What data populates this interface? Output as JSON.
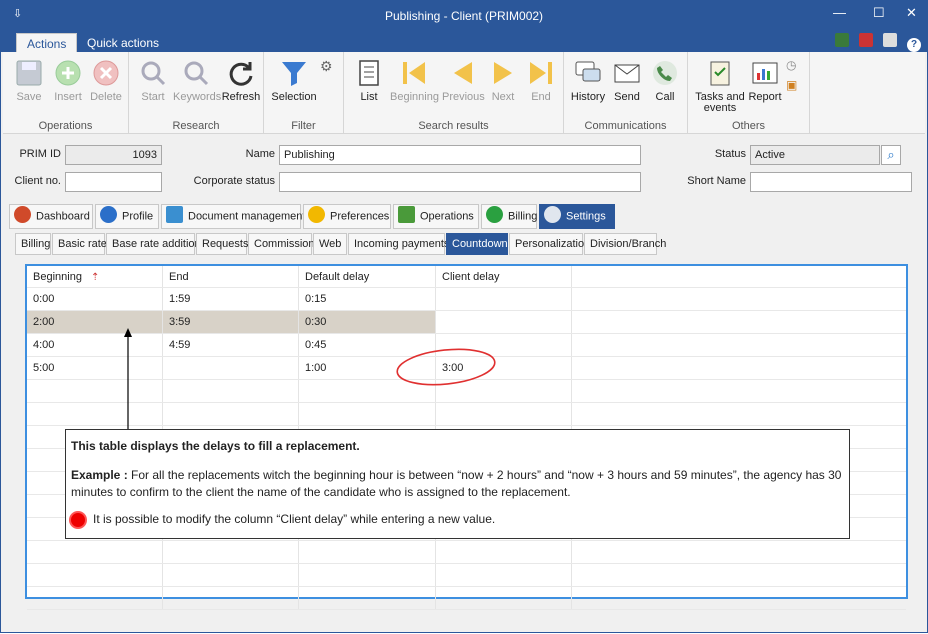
{
  "window": {
    "title": "Publishing - Client (PRIM002)",
    "menu_glyph": "⇩",
    "min": "—",
    "max": "☐",
    "close": "✕"
  },
  "ribbon_tabs": [
    {
      "label": "Actions"
    },
    {
      "label": "Quick actions"
    }
  ],
  "ribbon": {
    "groups": [
      {
        "label": "Operations",
        "buttons": [
          {
            "label": "Save",
            "enabled": false
          },
          {
            "label": "Insert",
            "enabled": false
          },
          {
            "label": "Delete",
            "enabled": false
          }
        ]
      },
      {
        "label": "Research",
        "buttons": [
          {
            "label": "Start",
            "enabled": false
          },
          {
            "label": "Keywords",
            "enabled": false
          },
          {
            "label": "Refresh",
            "enabled": true
          }
        ]
      },
      {
        "label": "Filter",
        "buttons": [
          {
            "label": "Selection",
            "enabled": true
          }
        ]
      },
      {
        "label": "Search results",
        "buttons": [
          {
            "label": "List",
            "enabled": true
          },
          {
            "label": "Beginning",
            "enabled": false
          },
          {
            "label": "Previous",
            "enabled": false
          },
          {
            "label": "Next",
            "enabled": false
          },
          {
            "label": "End",
            "enabled": false
          }
        ]
      },
      {
        "label": "Communications",
        "buttons": [
          {
            "label": "History",
            "enabled": true
          },
          {
            "label": "Send",
            "enabled": true
          },
          {
            "label": "Call",
            "enabled": true
          }
        ]
      },
      {
        "label": "Others",
        "buttons": [
          {
            "label": "Tasks and events",
            "line1": "Tasks and",
            "line2": "events",
            "enabled": true
          },
          {
            "label": "Report",
            "enabled": true
          }
        ]
      }
    ]
  },
  "header": {
    "prim_id_label": "PRIM ID",
    "prim_id_value": "1093",
    "name_label": "Name",
    "name_value": "Publishing",
    "status_label": "Status",
    "status_value": "Active",
    "client_no_label": "Client no.",
    "client_no_value": "",
    "corporate_status_label": "Corporate status",
    "corporate_status_value": "",
    "short_name_label": "Short Name",
    "short_name_value": ""
  },
  "main_tabs": [
    {
      "label": "Dashboard",
      "color": "#d04a2a"
    },
    {
      "label": "Profile",
      "color": "#2b6fc9"
    },
    {
      "label": "Document management",
      "color": "#3a8fd0"
    },
    {
      "label": "Preferences",
      "color": "#f2b800"
    },
    {
      "label": "Operations",
      "color": "#4a9a3a"
    },
    {
      "label": "Billing",
      "color": "#2aa040"
    },
    {
      "label": "Settings",
      "color": "#6a7a8a"
    }
  ],
  "sub_tabs": [
    {
      "label": "Billing"
    },
    {
      "label": "Basic rate"
    },
    {
      "label": "Base rate addition"
    },
    {
      "label": "Requests"
    },
    {
      "label": "Commissions"
    },
    {
      "label": "Web"
    },
    {
      "label": "Incoming payments"
    },
    {
      "label": "Countdown"
    },
    {
      "label": "Personalization"
    },
    {
      "label": "Division/Branch"
    }
  ],
  "table": {
    "columns": [
      "Beginning",
      "End",
      "Default delay",
      "Client delay"
    ],
    "rows": [
      [
        "0:00",
        "1:59",
        "0:15",
        ""
      ],
      [
        "2:00",
        "3:59",
        "0:30",
        ""
      ],
      [
        "4:00",
        "4:59",
        "0:45",
        ""
      ],
      [
        "5:00",
        "",
        "1:00",
        "3:00"
      ]
    ]
  },
  "callout": {
    "heading": "This table displays the delays to fill a replacement.",
    "example_label": "Example :",
    "example_text": "For all the replacements witch the beginning hour is between “now + 2 hours” and “now + 3 hours and 59 minutes”, the agency has 30 minutes to confirm to the client the name of the candidate who is assigned to the replacement.",
    "note": "It is possible to modify the column “Client delay” while entering a new value."
  },
  "colors": {
    "accent": "#2b579a",
    "selection": "#d8d2c8",
    "annotation_red": "#e03030"
  }
}
